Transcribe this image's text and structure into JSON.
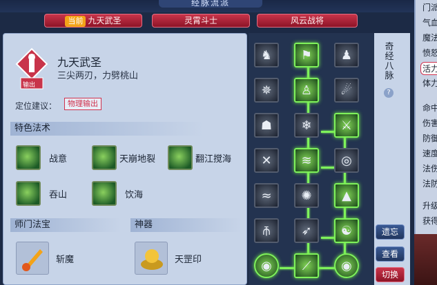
{
  "window_title": "经脉流派",
  "tabs": [
    {
      "badge": "当前",
      "label": "九天武圣"
    },
    {
      "label": "灵霄斗士"
    },
    {
      "label": "风云战将"
    }
  ],
  "sect": {
    "emblem_text": "输出",
    "name": "九天武圣",
    "motto": "三尖两刃，力劈桃山",
    "role_label": "定位建议：",
    "role_value": "物理输出"
  },
  "special_spells": {
    "header": "特色法术",
    "items": [
      {
        "name": "战意",
        "icon": "swirl-icon"
      },
      {
        "name": "天崩地裂",
        "icon": "mountain-crack-icon"
      },
      {
        "name": "翻江搅海",
        "icon": "wave-icon"
      },
      {
        "name": "吞山",
        "icon": "burst-icon"
      },
      {
        "name": "饮海",
        "icon": "whirlpool-icon"
      }
    ]
  },
  "treasure": {
    "header": "师门法宝",
    "name": "斩魔",
    "icon": "flame-sword-icon"
  },
  "artifact": {
    "header": "神器",
    "name": "天罡印",
    "icon": "golden-seal-icon"
  },
  "meridian": {
    "vertical_label": "奇经八脉",
    "help": "?",
    "nodes": [
      {
        "icon": "armored-figure-icon",
        "active": false
      },
      {
        "icon": "banner-icon",
        "active": true
      },
      {
        "icon": "warrior-icon",
        "active": false
      },
      {
        "icon": "vortex-icon",
        "active": false
      },
      {
        "icon": "silhouette-icon",
        "active": true
      },
      {
        "icon": "comet-icon",
        "active": false
      },
      {
        "icon": "flexing-figure-icon",
        "active": false
      },
      {
        "icon": "snowflake-icon",
        "active": false
      },
      {
        "icon": "dragon-icon",
        "active": true
      },
      {
        "icon": "crossed-blades-icon",
        "active": false
      },
      {
        "icon": "wind-blades-icon",
        "active": true
      },
      {
        "icon": "spiral-icon",
        "active": false
      },
      {
        "icon": "flame-waves-icon",
        "active": false
      },
      {
        "icon": "sunburst-icon",
        "active": false
      },
      {
        "icon": "peak-icon",
        "active": true
      },
      {
        "icon": "trident-icon",
        "active": false
      },
      {
        "icon": "spear-icon",
        "active": false
      },
      {
        "icon": "meditation-icon",
        "active": true
      },
      {
        "icon": "swirl-orb-icon",
        "active": true
      },
      {
        "icon": "claw-icon",
        "active": true
      },
      {
        "icon": "swirl-orb-icon",
        "active": true
      }
    ]
  },
  "buttons": {
    "forget": "遗忘",
    "view": "查看",
    "switch": "切换"
  },
  "stats_partial": [
    "门派",
    "气血",
    "魔法",
    "愤怒",
    "活力",
    "体力",
    "命中",
    "伤害",
    "防御",
    "速度",
    "法伤",
    "法防",
    "升级",
    "获得"
  ],
  "colors": {
    "active_node": "#7ff25b",
    "tab_red": "#c8344a",
    "badge_orange": "#f3a318"
  }
}
